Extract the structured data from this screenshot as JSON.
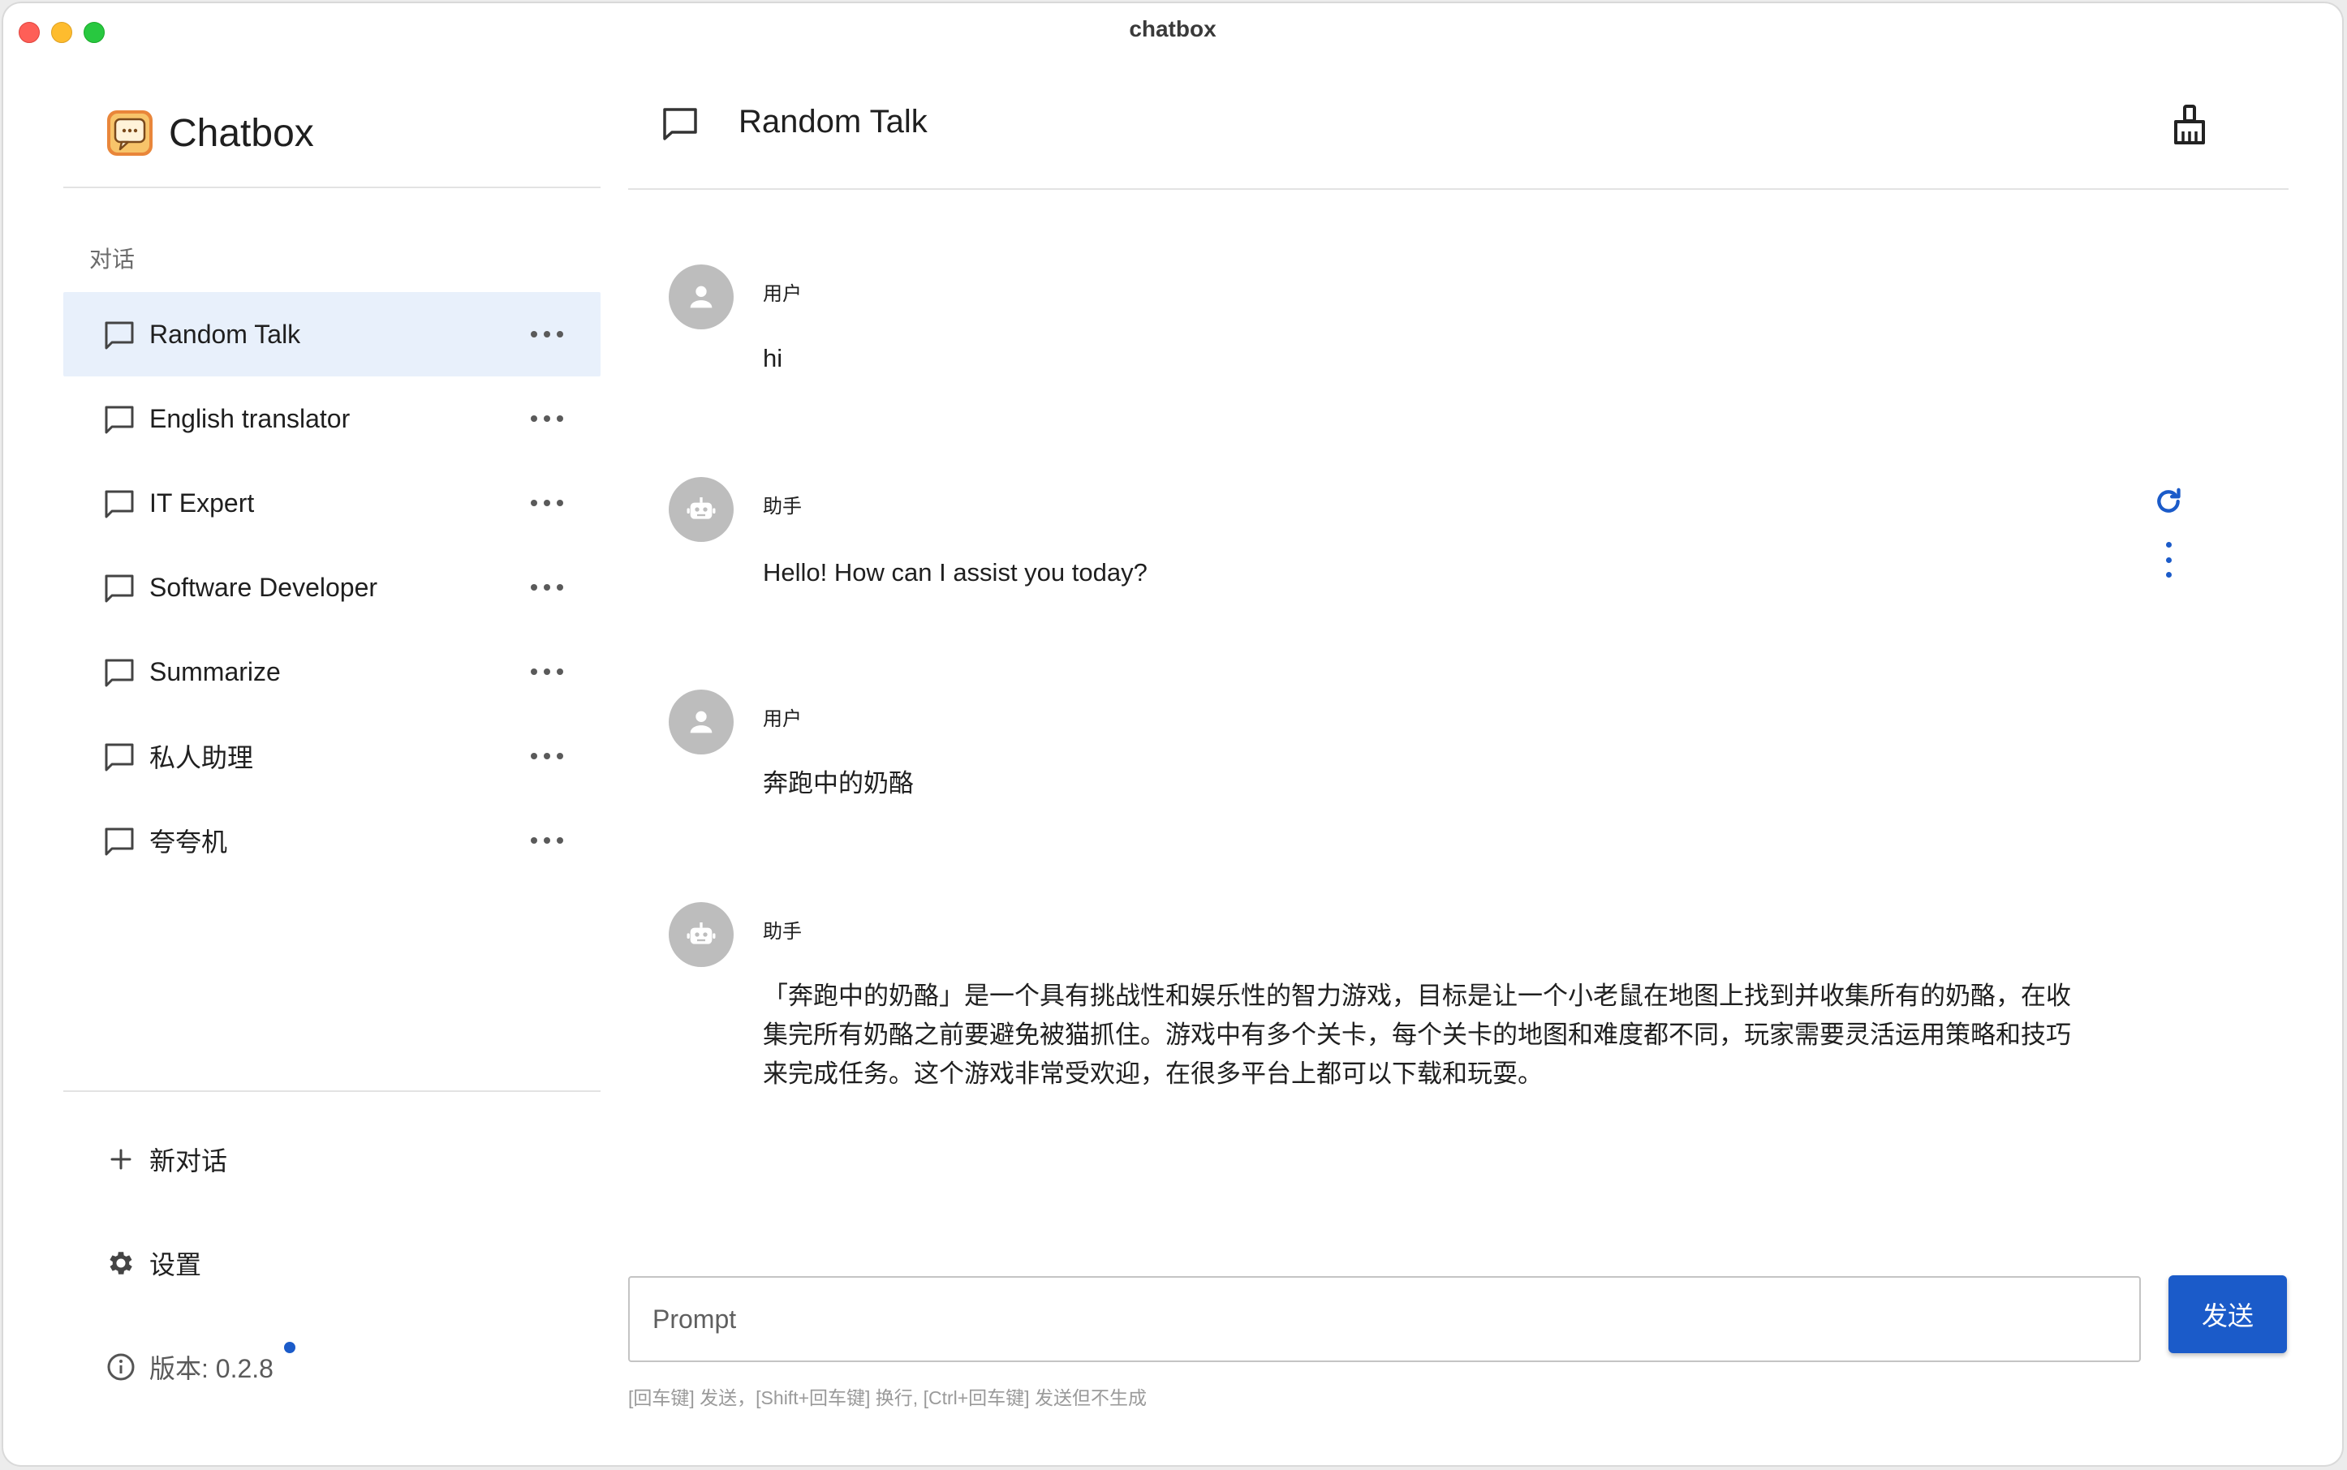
{
  "window": {
    "title": "chatbox"
  },
  "brand": {
    "name": "Chatbox"
  },
  "sidebar": {
    "section_label": "对话",
    "conversations": [
      {
        "label": "Random Talk",
        "active": true
      },
      {
        "label": "English translator",
        "active": false
      },
      {
        "label": "IT Expert",
        "active": false
      },
      {
        "label": "Software Developer",
        "active": false
      },
      {
        "label": "Summarize",
        "active": false
      },
      {
        "label": "私人助理",
        "active": false
      },
      {
        "label": "夸夸机",
        "active": false
      }
    ],
    "new_chat_label": "新对话",
    "settings_label": "设置",
    "version_label": "版本: 0.2.8"
  },
  "chat": {
    "title": "Random Talk",
    "messages": [
      {
        "role": "用户",
        "type": "user",
        "text": "hi"
      },
      {
        "role": "助手",
        "type": "assistant",
        "text": "Hello! How can I assist you today?"
      },
      {
        "role": "用户",
        "type": "user",
        "text": "奔跑中的奶酪"
      },
      {
        "role": "助手",
        "type": "assistant",
        "text": "「奔跑中的奶酪」是一个具有挑战性和娱乐性的智力游戏，目标是让一个小老鼠在地图上找到并收集所有的奶酪，在收集完所有奶酪之前要避免被猫抓住。游戏中有多个关卡，每个关卡的地图和难度都不同，玩家需要灵活运用策略和技巧来完成任务。这个游戏非常受欢迎，在很多平台上都可以下载和玩耍。"
      }
    ]
  },
  "composer": {
    "placeholder": "Prompt",
    "value": "",
    "send_label": "发送",
    "hint": "[回车键] 发送，[Shift+回车键] 换行, [Ctrl+回车键] 发送但不生成"
  },
  "colors": {
    "accent": "#1b5bc9",
    "active_item_bg": "#e8f0fb",
    "avatar_bg": "#bdbdbd"
  },
  "icons": {
    "conversation": "chat-bubble-outline-icon",
    "clean": "broom-icon",
    "refresh": "refresh-icon",
    "more": "more-horizontal-icon",
    "kebab": "more-vertical-icon",
    "add": "plus-icon",
    "settings": "gear-icon",
    "info": "info-icon",
    "user": "person-icon",
    "assistant": "robot-icon"
  }
}
